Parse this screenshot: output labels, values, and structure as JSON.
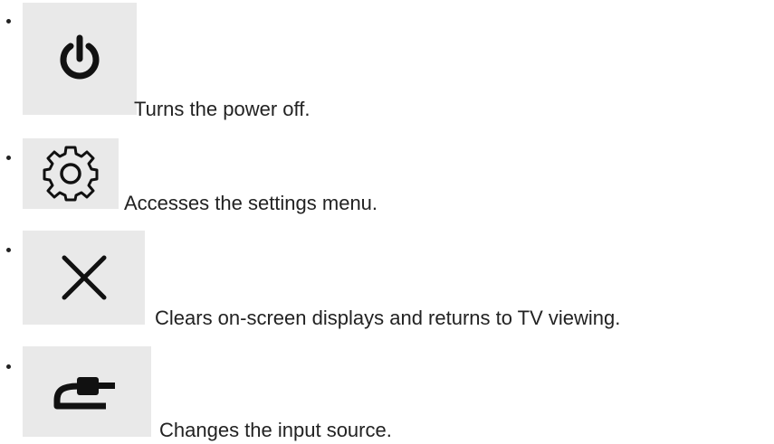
{
  "items": [
    {
      "icon": "power-icon",
      "text": "Turns the power off."
    },
    {
      "icon": "gear-icon",
      "text": "Accesses the settings menu."
    },
    {
      "icon": "close-icon",
      "text": "Clears on-screen displays and returns to TV viewing."
    },
    {
      "icon": "input-source-icon",
      "text": "Changes the input source."
    }
  ],
  "colors": {
    "icon_background": "#e9e9e9",
    "icon_stroke": "#111111",
    "text": "#222222"
  }
}
